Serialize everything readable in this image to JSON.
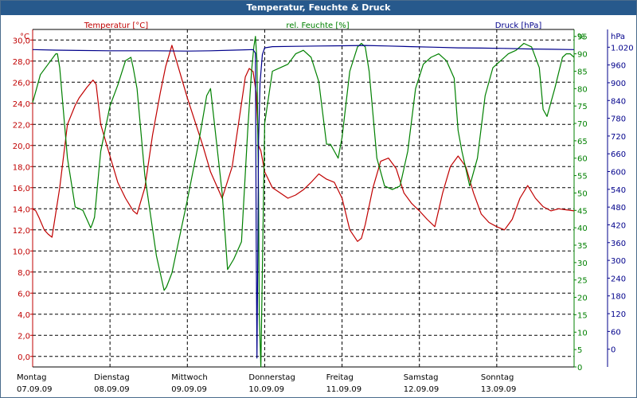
{
  "window": {
    "title": "Temperatur, Feuchte & Druck"
  },
  "colors": {
    "temperature": "#c00000",
    "humidity": "#008000",
    "pressure": "#00008b",
    "titlebar": "#27598c",
    "grid": "#000000"
  },
  "chart_data": {
    "type": "line",
    "title": "Temperatur, Feuchte & Druck",
    "grid": true,
    "x_axis": {
      "range": [
        "07.09.09",
        "14.09.09"
      ],
      "ticks": [
        {
          "day": "Montag",
          "date": "07.09.09"
        },
        {
          "day": "Dienstag",
          "date": "08.09.09"
        },
        {
          "day": "Mittwoch",
          "date": "09.09.09"
        },
        {
          "day": "Donnerstag",
          "date": "10.09.09"
        },
        {
          "day": "Freitag",
          "date": "11.09.09"
        },
        {
          "day": "Samstag",
          "date": "12.09.09"
        },
        {
          "day": "Sonntag",
          "date": "13.09.09"
        }
      ]
    },
    "axes": {
      "temperature": {
        "title": "Temperatur [°C]",
        "unit": "°C",
        "range": [
          -1,
          31
        ],
        "ticks": [
          "0,0",
          "2,0",
          "4,0",
          "6,0",
          "8,0",
          "10,0",
          "12,0",
          "14,0",
          "16,0",
          "18,0",
          "20,0",
          "22,0",
          "24,0",
          "26,0",
          "28,0",
          "30,0"
        ]
      },
      "humidity": {
        "title": "rel. Feuchte [%]",
        "unit": "%",
        "range": [
          0,
          97
        ],
        "ticks": [
          "0",
          "5",
          "10",
          "15",
          "20",
          "25",
          "30",
          "35",
          "40",
          "45",
          "50",
          "55",
          "60",
          "65",
          "70",
          "75",
          "80",
          "85",
          "90",
          "95"
        ]
      },
      "pressure": {
        "title": "Druck [hPa]",
        "unit": "hPa",
        "range": [
          -60,
          1080
        ],
        "ticks": [
          "0",
          "60",
          "120",
          "180",
          "240",
          "300",
          "360",
          "420",
          "480",
          "540",
          "600",
          "660",
          "720",
          "780",
          "840",
          "900",
          "960",
          "1.020"
        ]
      }
    },
    "series": [
      {
        "name": "Temperatur [°C]",
        "axis": "temperature",
        "color": "#c00000",
        "x": [
          0,
          0.04,
          0.08,
          0.15,
          0.2,
          0.25,
          0.35,
          0.45,
          0.55,
          0.6,
          0.7,
          0.78,
          0.82,
          0.88,
          1.0,
          1.1,
          1.2,
          1.3,
          1.35,
          1.45,
          1.55,
          1.65,
          1.72,
          1.8,
          2.0,
          2.2,
          2.3,
          2.45,
          2.58,
          2.7,
          2.75,
          2.8,
          2.85,
          2.89,
          2.92,
          2.95,
          3.0,
          3.1,
          3.2,
          3.3,
          3.4,
          3.5,
          3.6,
          3.7,
          3.8,
          3.9,
          4.0,
          4.1,
          4.2,
          4.25,
          4.3,
          4.4,
          4.5,
          4.6,
          4.7,
          4.8,
          4.9,
          5.0,
          5.1,
          5.2,
          5.3,
          5.4,
          5.5,
          5.6,
          5.7,
          5.8,
          5.9,
          6.0,
          6.1,
          6.2,
          6.3,
          6.4,
          6.5,
          6.6,
          6.7,
          6.8,
          6.9,
          7.0
        ],
        "y": [
          14.0,
          13.8,
          13.2,
          12.0,
          11.6,
          11.3,
          16.0,
          22.0,
          23.8,
          24.5,
          25.5,
          26.2,
          25.8,
          22.0,
          19.0,
          16.5,
          15.0,
          13.8,
          13.5,
          16.0,
          21.0,
          25.0,
          27.5,
          29.5,
          24.5,
          20.0,
          17.5,
          15.0,
          18.0,
          24.0,
          26.5,
          27.3,
          27.0,
          25.0,
          20.0,
          19.5,
          17.5,
          16.0,
          15.5,
          15.0,
          15.3,
          15.8,
          16.5,
          17.3,
          16.8,
          16.5,
          15.0,
          12.0,
          10.9,
          11.2,
          12.5,
          16.0,
          18.5,
          18.8,
          17.8,
          15.5,
          14.5,
          13.8,
          13.0,
          12.3,
          15.5,
          18.0,
          19.0,
          18.0,
          15.5,
          13.5,
          12.7,
          12.3,
          12.0,
          13.0,
          15.0,
          16.2,
          15.0,
          14.2,
          13.8,
          14.0,
          13.9,
          13.8
        ]
      },
      {
        "name": "rel. Feuchte [%]",
        "axis": "humidity",
        "color": "#008000",
        "x": [
          0,
          0.05,
          0.1,
          0.2,
          0.3,
          0.32,
          0.35,
          0.45,
          0.55,
          0.65,
          0.75,
          0.77,
          0.8,
          0.88,
          1.0,
          1.1,
          1.2,
          1.27,
          1.3,
          1.35,
          1.45,
          1.6,
          1.7,
          1.73,
          1.8,
          2.0,
          2.15,
          2.25,
          2.3,
          2.45,
          2.52,
          2.6,
          2.7,
          2.78,
          2.83,
          2.86,
          2.88,
          2.9,
          2.92,
          2.93,
          2.95,
          3.0,
          3.1,
          3.2,
          3.3,
          3.4,
          3.5,
          3.6,
          3.7,
          3.8,
          3.85,
          3.9,
          3.95,
          4.0,
          4.1,
          4.2,
          4.25,
          4.3,
          4.35,
          4.45,
          4.55,
          4.65,
          4.75,
          4.85,
          4.95,
          5.05,
          5.15,
          5.25,
          5.35,
          5.45,
          5.5,
          5.55,
          5.65,
          5.75,
          5.85,
          5.95,
          6.05,
          6.15,
          6.25,
          6.35,
          6.45,
          6.55,
          6.6,
          6.65,
          6.75,
          6.85,
          6.9,
          6.95,
          7.0
        ],
        "y": [
          76,
          80,
          84,
          87,
          90,
          90,
          86,
          60,
          46,
          45,
          40,
          41,
          43,
          62,
          75,
          81,
          88,
          89,
          86,
          80,
          55,
          32,
          22,
          23,
          27,
          48,
          65,
          78,
          80,
          50,
          28,
          31,
          36,
          68,
          85,
          92,
          95,
          88,
          50,
          15,
          0,
          70,
          85,
          86,
          87,
          90,
          91,
          89,
          82,
          64,
          64,
          62,
          60,
          66,
          85,
          92,
          93,
          92,
          85,
          60,
          52,
          51,
          52,
          62,
          80,
          87,
          89,
          90,
          88,
          83,
          68,
          62,
          52,
          60,
          78,
          86,
          88,
          90,
          91,
          93,
          92,
          86,
          74,
          72,
          80,
          89,
          90,
          90,
          89
        ]
      },
      {
        "name": "Druck [hPa]",
        "axis": "pressure",
        "color": "#00008b",
        "x": [
          0,
          0.3,
          0.6,
          1.0,
          1.3,
          1.6,
          2.0,
          2.3,
          2.6,
          2.85,
          2.88,
          2.89,
          2.9,
          2.91,
          2.92,
          2.94,
          2.97,
          3.0,
          3.1,
          3.4,
          3.7,
          4.0,
          4.3,
          4.6,
          4.9,
          5.2,
          5.5,
          5.8,
          6.1,
          6.4,
          6.7,
          7.0
        ],
        "y": [
          1012,
          1010,
          1009,
          1008,
          1008,
          1008,
          1007,
          1008,
          1010,
          1012,
          1000,
          400,
          -30,
          300,
          700,
          900,
          995,
          1018,
          1022,
          1023,
          1024,
          1025,
          1026,
          1024,
          1022,
          1020,
          1018,
          1017,
          1016,
          1014,
          1013,
          1012
        ]
      }
    ]
  }
}
